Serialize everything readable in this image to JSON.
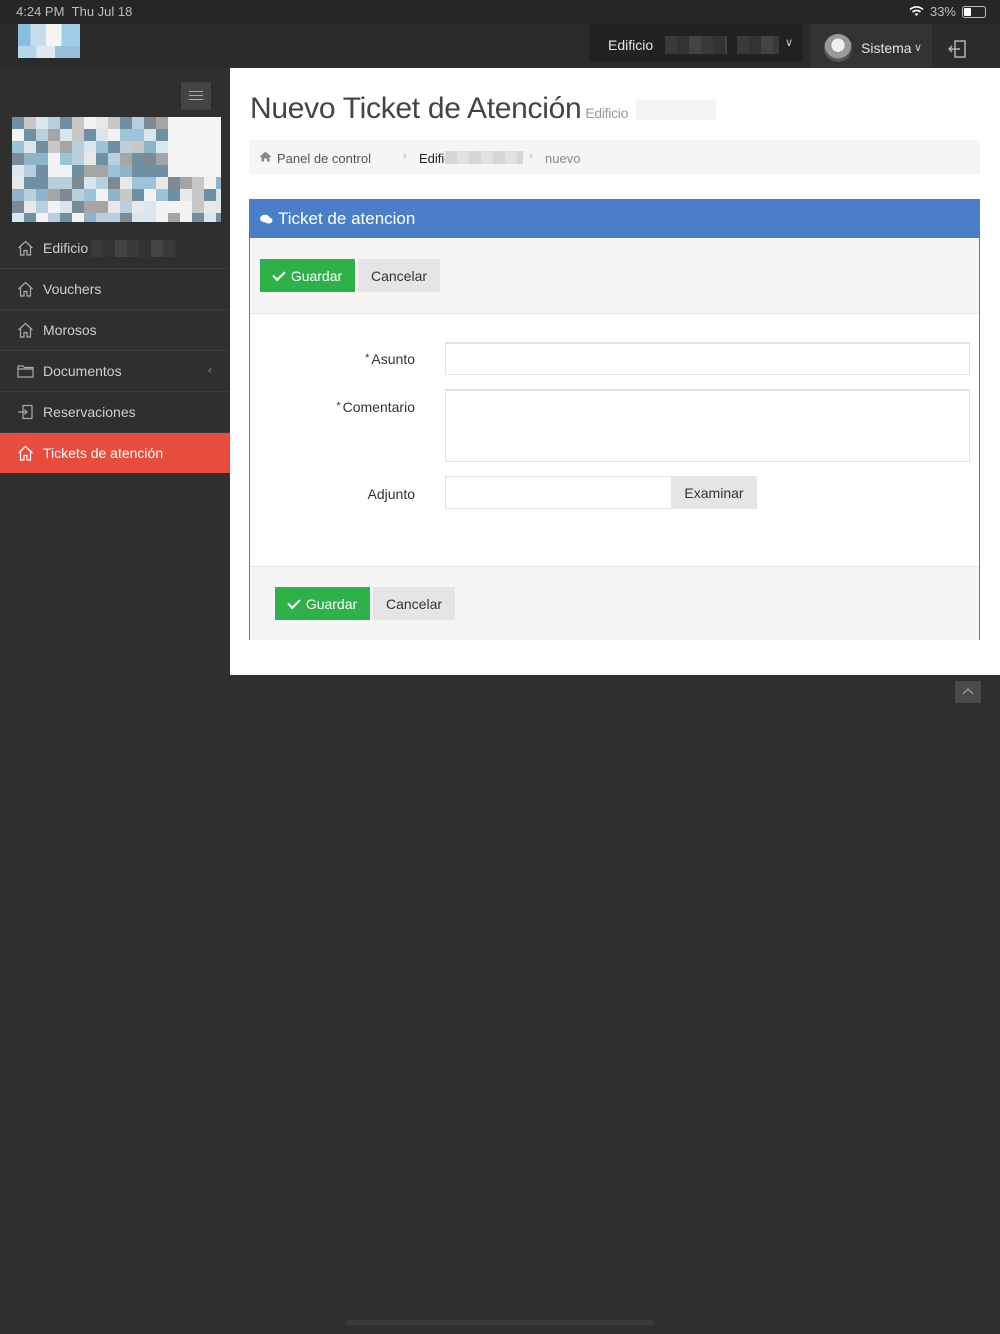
{
  "status_bar": {
    "time": "4:24 PM",
    "date": "Thu Jul 18",
    "battery": "33%",
    "battery_level": 0.33
  },
  "header": {
    "building_select": {
      "label": "Edificio"
    },
    "user": {
      "name": "Sistema"
    },
    "icons": [
      "wifi-icon",
      "battery-icon",
      "chevron-down-icon",
      "logout-icon"
    ]
  },
  "sidebar": {
    "items": [
      {
        "label": "Edificio",
        "icon": "home-icon"
      },
      {
        "label": "Vouchers",
        "icon": "home-icon"
      },
      {
        "label": "Morosos",
        "icon": "home-icon"
      },
      {
        "label": "Documentos",
        "icon": "folder-icon"
      },
      {
        "label": "Reservaciones",
        "icon": "login-icon"
      },
      {
        "label": "Tickets de atención",
        "icon": "home-icon",
        "active": true
      }
    ],
    "active_color": "#e74c3c"
  },
  "main": {
    "title": "Nuevo Ticket de Atención",
    "subtitle": "Edificio",
    "breadcrumb": [
      "Panel de control",
      "Edificio",
      "nuevo"
    ],
    "panel": {
      "title": "Ticket de atencion",
      "save_label": "Guardar",
      "cancel_label": "Cancelar",
      "fields": {
        "asunto_label": "Asunto",
        "comentario_label": "Comentario",
        "adjunto_label": "Adjunto",
        "required_mark": "*",
        "browse_label": "Examinar"
      }
    }
  },
  "colors": {
    "panel_header": "#4a7ec9",
    "save_button": "#2fb14a",
    "sidebar_bg": "#2f2f2f"
  }
}
